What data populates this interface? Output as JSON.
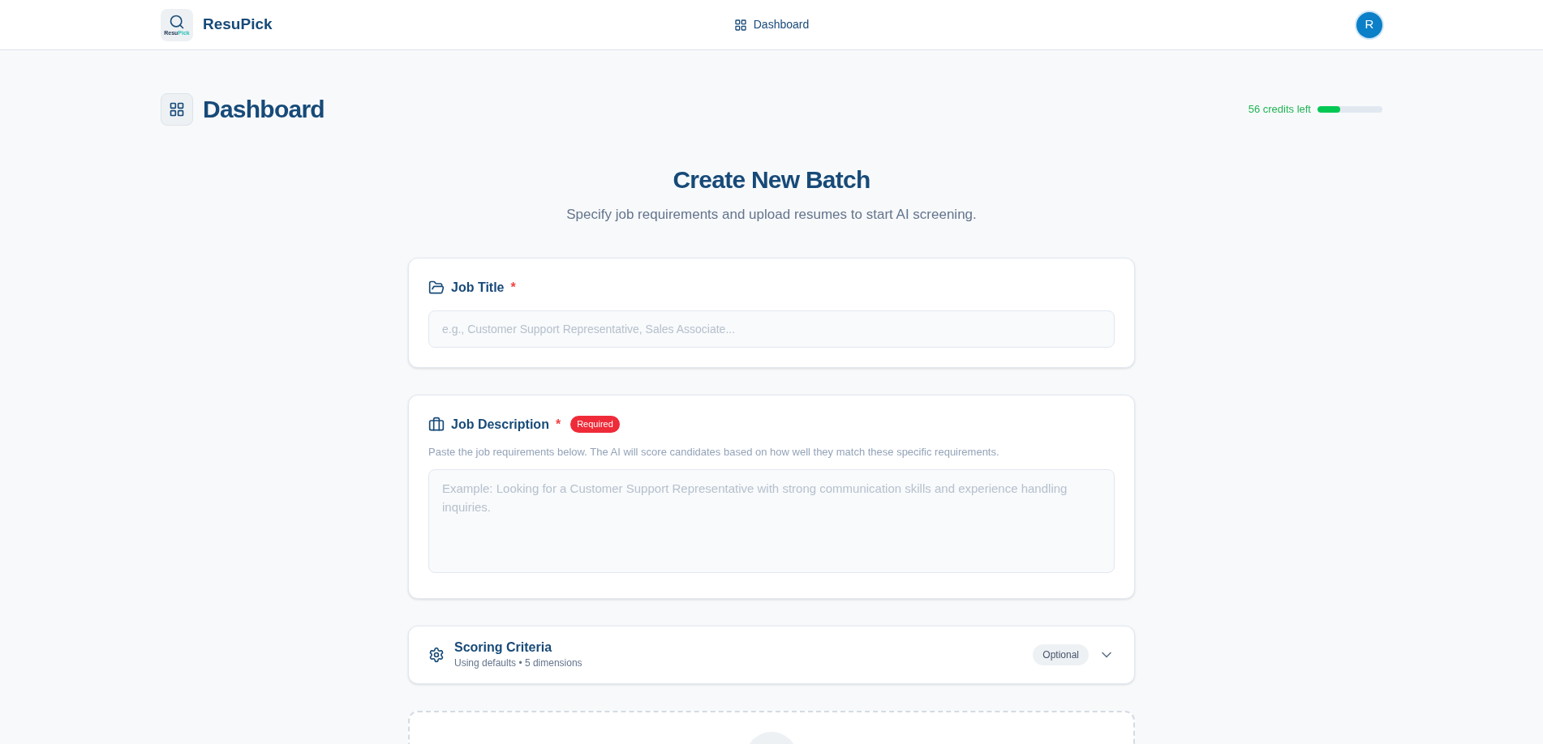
{
  "header": {
    "brand": "ResuPick",
    "logo_text": {
      "part1": "Resu",
      "part2": "Pick"
    },
    "nav": [
      {
        "label": "Dashboard",
        "selected": true
      }
    ],
    "avatar": "R"
  },
  "page": {
    "title": "Dashboard",
    "credits": {
      "reading": "56 credits left",
      "level": 0.35
    }
  },
  "batch": {
    "title": "Create New Batch",
    "subtitle": "Specify job requirements and upload resumes to start AI screening."
  },
  "job_title": {
    "label": "Job Title",
    "required_mark": "*",
    "placeholder": "e.g., Customer Support Representative, Sales Associate..."
  },
  "job_description": {
    "label": "Job Description",
    "required_mark": "*",
    "badge": "Required",
    "hint": "Paste the job requirements below. The AI will score candidates based on how well they match these specific requirements.",
    "placeholder": "Example: Looking for a Customer Support Representative with strong communication skills and experience handling inquiries."
  },
  "scoring": {
    "title": "Scoring Criteria",
    "summary": "Using defaults • 5 dimensions",
    "badge": "Optional",
    "expanded": false
  }
}
